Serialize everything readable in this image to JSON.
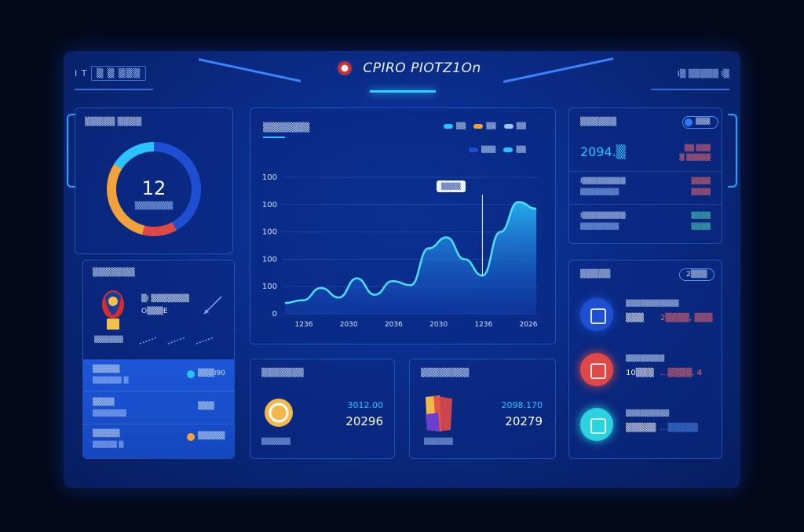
{
  "header": {
    "left_text": "I T",
    "left_box": "▒ ▒ ▒▒▒",
    "title": "CPIRO PIOTZ1On",
    "right_text": "I▒ ▒▒▒▒▒ I▒"
  },
  "donut_panel": {
    "title": "▒▒▒▒▒ ▒▒▒▒",
    "center_value": "12",
    "center_label": "▒▒▒▒▒▒▒",
    "segments": [
      {
        "name": "blue",
        "fraction": 0.42,
        "color": "#1e4fd2"
      },
      {
        "name": "red",
        "fraction": 0.12,
        "color": "#e04848"
      },
      {
        "name": "orange",
        "fraction": 0.3,
        "color": "#f2a23a"
      },
      {
        "name": "cyan",
        "fraction": 0.16,
        "color": "#2bc3ff"
      }
    ]
  },
  "trophy_panel": {
    "title": "▒▒▒▒▒▒▒",
    "headline": "▒I ▒▒▒▒▒▒▒",
    "subline": "O▒▒▒E",
    "caption": "▒▒▒▒▒▒",
    "sublist": [
      {
        "label": "▒▒▒▒▒",
        "value": "▒▒▒I90",
        "dot_color": "#2bc3ff",
        "sub": "▒▒▒▒▒▒ ▒"
      },
      {
        "label": "▒▒▒▒",
        "value": "▒▒▒",
        "dot_color": "#5ea4ff",
        "sub": "▒▒▒▒▒▒▒"
      },
      {
        "label": "▒▒▒▒▒",
        "value": "▒▒▒▒▒",
        "dot_color": "#f2a23a",
        "sub": "▒▒▒▒▒ ▒"
      }
    ]
  },
  "chart_panel": {
    "title": "▒▒▒▒▒▒▒",
    "legend": [
      {
        "label": "▒▒",
        "color": "#2bc3ff"
      },
      {
        "label": "▒▒",
        "color": "#f2a23a"
      },
      {
        "label": "▒▒",
        "color": "#9ec3ff"
      }
    ],
    "legend2": [
      {
        "label": "▒▒▒",
        "color": "#1e4fd2"
      },
      {
        "label": "▒▒",
        "color": "#2bc3ff"
      }
    ],
    "tooltip": "▒▒▒▒"
  },
  "chart_data": {
    "type": "area",
    "x": [
      "1236",
      "2030",
      "2036",
      "2030",
      "1236",
      "2026"
    ],
    "ytick_labels": [
      "0",
      "100",
      "100",
      "100",
      "100",
      "100"
    ],
    "values": [
      8,
      10,
      19,
      12,
      26,
      14,
      24,
      21,
      48,
      56,
      40,
      28,
      60,
      82,
      77
    ],
    "ylim": [
      0,
      100
    ],
    "grid": true
  },
  "stat_cards": [
    {
      "title": "▒▒▒▒▒▒▒",
      "top": "3012.00",
      "main": "20296",
      "sub": "▒▒▒▒▒▒",
      "icon": "coin-icon"
    },
    {
      "title": "▒▒▒▒▒▒▒▒",
      "top": "2098.170",
      "main": "20279",
      "sub": "▒▒▒▒▒▒",
      "icon": "app-icon"
    }
  ],
  "stats_panel": {
    "title": "▒▒▒▒▒▒",
    "toggle": "▒▒▒",
    "headline": "2094.▒",
    "headline_note": "▒ ▒▒▒▒▒",
    "right_top": "▒▒ ▒▒▒",
    "rows": [
      {
        "label": "I▒▒▒▒▒▒▒▒▒",
        "sub": "▒▒▒▒▒▒▒▒",
        "right": "▒▒▒▒",
        "right2": "▒▒▒▒"
      },
      {
        "label": "I▒▒▒▒▒▒▒▒▒",
        "sub": "▒▒▒▒▒▒▒▒",
        "right": "▒▒▒▒",
        "right2": "▒▒▒▒"
      }
    ]
  },
  "rank_panel": {
    "title": "▒▒▒▒▒",
    "badge": "2▒▒▒",
    "items": [
      {
        "line1": "▒▒▒▒▒▒▒▒▒▒▒",
        "value": "▒▒▒",
        "value2": "2▒▒▒▒, ▒▒▒",
        "color": "#1e4fd2",
        "icon": "chart-icon"
      },
      {
        "line1": "▒▒▒▒▒▒▒▒",
        "value": "10▒▒▒",
        "value2": "...▒▒▒▒, 4",
        "color": "#e04848",
        "icon": "card-icon"
      },
      {
        "line1": "▒▒▒▒▒▒▒▒▒",
        "value": "▒▒▒▒▒",
        "value2": "...▒▒▒▒▒",
        "color": "#2bd2e0",
        "icon": "refresh-icon"
      }
    ]
  },
  "colors": {
    "accent": "#2bc3ff",
    "panel_bg": "#0a2b86",
    "red": "#e04848",
    "orange": "#f2a23a"
  }
}
